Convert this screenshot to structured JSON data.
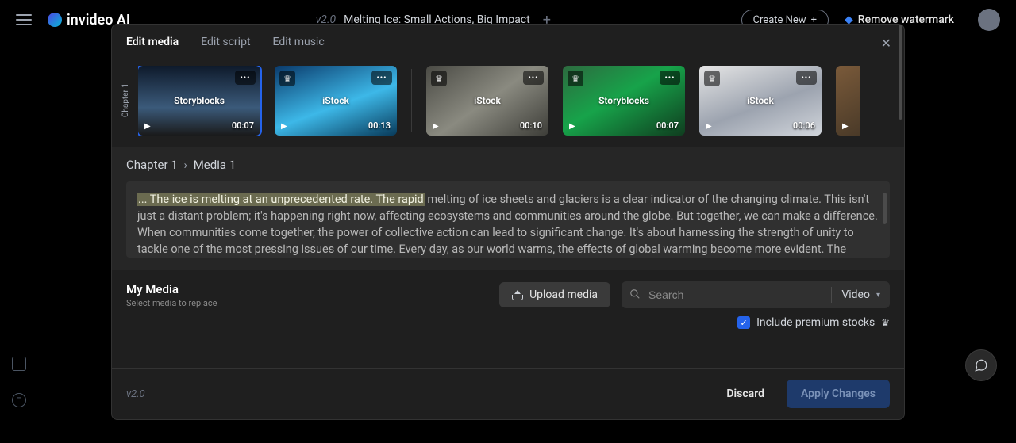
{
  "topbar": {
    "brand": "invideo AI",
    "version_tag": "v2.0",
    "project_title": "Melting Ice: Small Actions, Big Impact",
    "create_label": "Create New",
    "remove_wm_label": "Remove watermark"
  },
  "modal": {
    "tabs": {
      "edit_media": "Edit media",
      "edit_script": "Edit script",
      "edit_music": "Edit music"
    },
    "chapter_label": "Chapter 1",
    "thumbs": [
      {
        "watermark": "Storyblocks",
        "duration": "00:07",
        "premium": false,
        "selected": true
      },
      {
        "watermark": "iStock",
        "duration": "00:13",
        "premium": true,
        "selected": false
      },
      {
        "watermark": "iStock",
        "duration": "00:10",
        "premium": true,
        "selected": false
      },
      {
        "watermark": "Storyblocks",
        "duration": "00:07",
        "premium": true,
        "selected": false
      },
      {
        "watermark": "iStock",
        "duration": "00:06",
        "premium": true,
        "selected": false
      }
    ],
    "breadcrumb": {
      "chapter": "Chapter 1",
      "media": "Media 1"
    },
    "script": {
      "highlight": "... The ice is melting at an unprecedented rate. The rapid",
      "rest": " melting of ice sheets and glaciers is a clear indicator of the changing climate. This isn't just a distant problem; it's happening right now, affecting ecosystems and communities around the globe. But together, we can make a difference. When communities come together, the power of collective action can lead to significant change. It's about harnessing the strength of unity to tackle one of the most pressing issues of our time. Every day, as our world warms, the effects of global warming become more evident. The changing seasons, the rising temperatures, and the shifting"
    },
    "my_media": {
      "title": "My Media",
      "subtitle": "Select media to replace"
    },
    "upload_label": "Upload media",
    "search_placeholder": "Search",
    "type_filter": "Video",
    "include_premium_label": "Include premium stocks",
    "include_premium_checked": true,
    "footer": {
      "version": "v2.0",
      "discard": "Discard",
      "apply": "Apply Changes"
    }
  }
}
